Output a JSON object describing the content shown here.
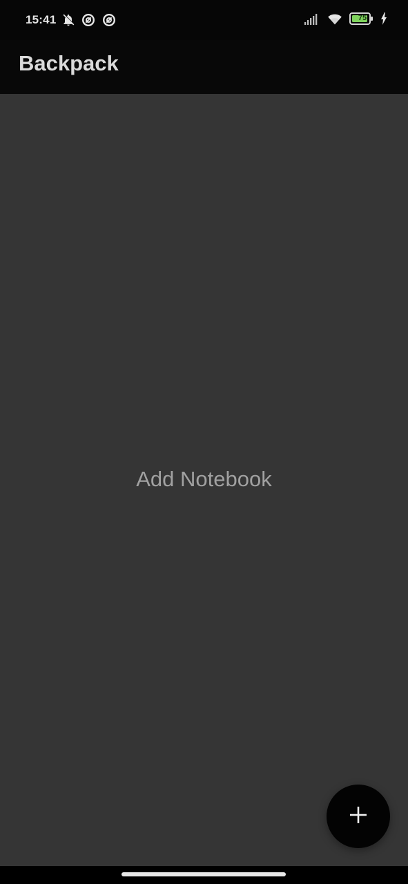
{
  "status_bar": {
    "time": "15:41",
    "battery_level": "75",
    "left_icons": [
      "bell-off-icon",
      "data-saver-icon",
      "data-saver-icon"
    ],
    "right_icons": [
      "cellular-signal-icon",
      "wifi-icon",
      "battery-icon",
      "charging-bolt-icon"
    ],
    "battery_color": "#7fd35d"
  },
  "app_bar": {
    "title": "Backpack"
  },
  "main": {
    "empty_message": "Add Notebook"
  },
  "fab": {
    "icon": "plus-icon"
  },
  "colors": {
    "background": "#353535",
    "app_bar": "#080808",
    "fab": "#030303",
    "text_primary": "#dadada",
    "text_secondary": "#a1a1a1"
  }
}
